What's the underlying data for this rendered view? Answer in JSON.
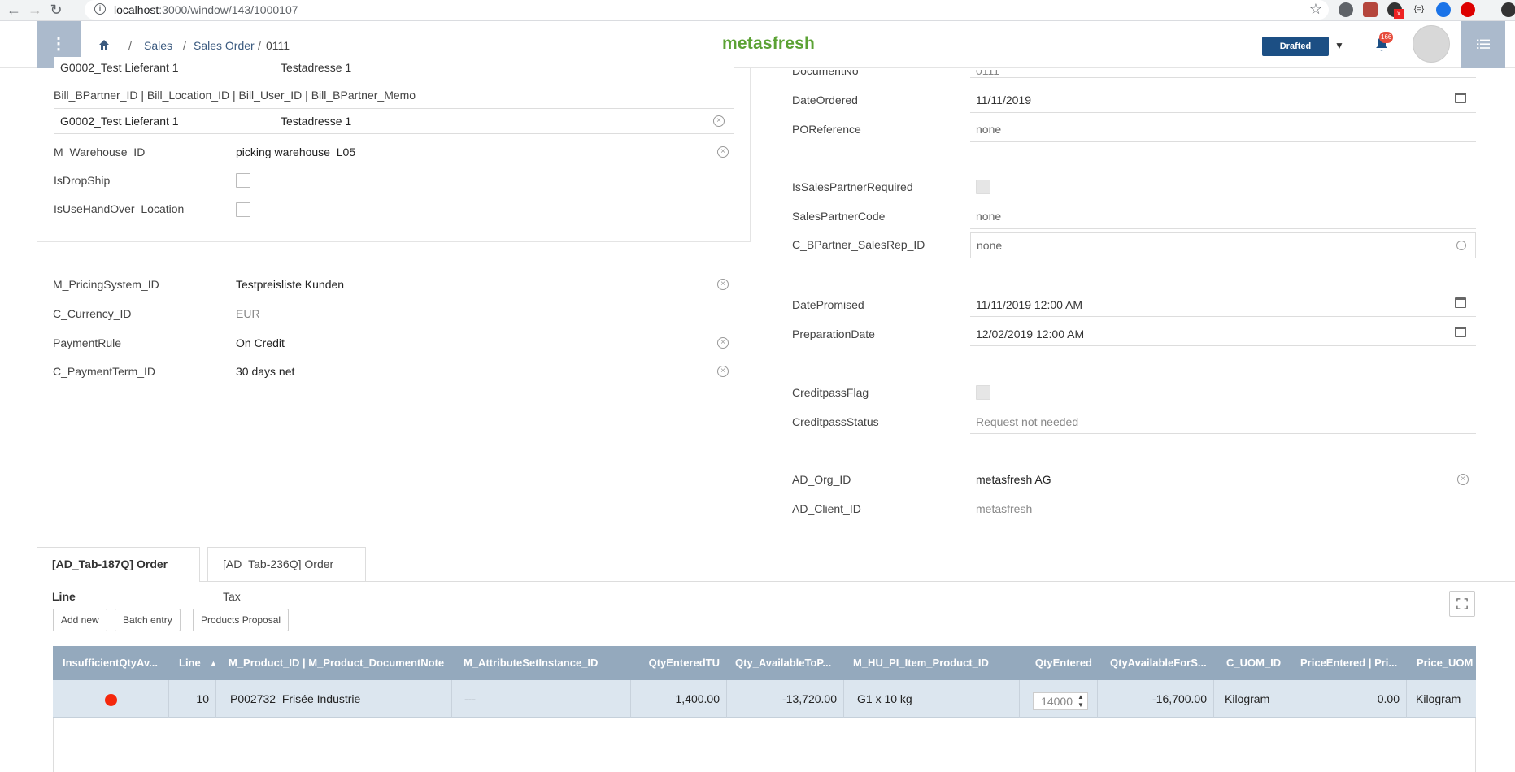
{
  "browser": {
    "url_host": "localhost",
    "url_path": ":3000/window/143/1000107",
    "badge_ext": "x"
  },
  "header": {
    "breadcrumb": [
      "Sales",
      "Sales Order",
      "0111"
    ],
    "logo": "metasfresh",
    "status": "Drafted",
    "notification_count": "166"
  },
  "left": {
    "partial_row": {
      "value1": "G0002_Test Lieferant 1",
      "value2": "Testadresse 1"
    },
    "bill_label": "Bill_BPartner_ID | Bill_Location_ID | Bill_User_ID | Bill_BPartner_Memo",
    "bill_value1": "G0002_Test Lieferant 1",
    "bill_value2": "Testadresse 1",
    "warehouse_label": "M_Warehouse_ID",
    "warehouse_value": "picking warehouse_L05",
    "dropship_label": "IsDropShip",
    "handover_label": "IsUseHandOver_Location",
    "pricing_label": "M_PricingSystem_ID",
    "pricing_value": "Testpreisliste Kunden",
    "currency_label": "C_Currency_ID",
    "currency_value": "EUR",
    "paymentrule_label": "PaymentRule",
    "paymentrule_value": "On Credit",
    "paymentterm_label": "C_PaymentTerm_ID",
    "paymentterm_value": "30 days net"
  },
  "right": {
    "docno_label": "DocumentNo",
    "docno_value": "0111",
    "dateordered_label": "DateOrdered",
    "dateordered_value": "11/11/2019",
    "poref_label": "POReference",
    "poref_value": "none",
    "salespartnerreq_label": "IsSalesPartnerRequired",
    "salespartnercode_label": "SalesPartnerCode",
    "salespartnercode_value": "none",
    "salesrep_label": "C_BPartner_SalesRep_ID",
    "salesrep_value": "none",
    "datepromised_label": "DatePromised",
    "datepromised_value": "11/11/2019 12:00 AM",
    "prepdate_label": "PreparationDate",
    "prepdate_value": "12/02/2019 12:00 AM",
    "creditflag_label": "CreditpassFlag",
    "creditstatus_label": "CreditpassStatus",
    "creditstatus_value": "Request not needed",
    "org_label": "AD_Org_ID",
    "org_value": "metasfresh AG",
    "client_label": "AD_Client_ID",
    "client_value": "metasfresh"
  },
  "tabs": [
    "[AD_Tab-187Q] Order Line",
    "[AD_Tab-236Q] Order Tax"
  ],
  "actions": [
    "Add new",
    "Batch entry",
    "Products Proposal"
  ],
  "table": {
    "headers": [
      "InsufficientQtyAv...",
      "Line",
      "M_Product_ID | M_Product_DocumentNote",
      "M_AttributeSetInstance_ID",
      "QtyEnteredTU",
      "Qty_AvailableToP...",
      "M_HU_PI_Item_Product_ID",
      "QtyEntered",
      "QtyAvailableForS...",
      "C_UOM_ID",
      "PriceEntered | Pri...",
      "Price_UOM"
    ],
    "sort_indicator": "▲",
    "row": {
      "line": "10",
      "product": "P002732_Frisée Industrie",
      "attribute": "---",
      "qty_tu": "1,400.00",
      "qty_available": "-13,720.00",
      "hu_pi": "G1 x 10 kg",
      "qty_entered": "14000",
      "qty_available_for_sale": "-16,700.00",
      "uom": "Kilogram",
      "price": "0.00",
      "price_uom": "Kilogram"
    }
  }
}
